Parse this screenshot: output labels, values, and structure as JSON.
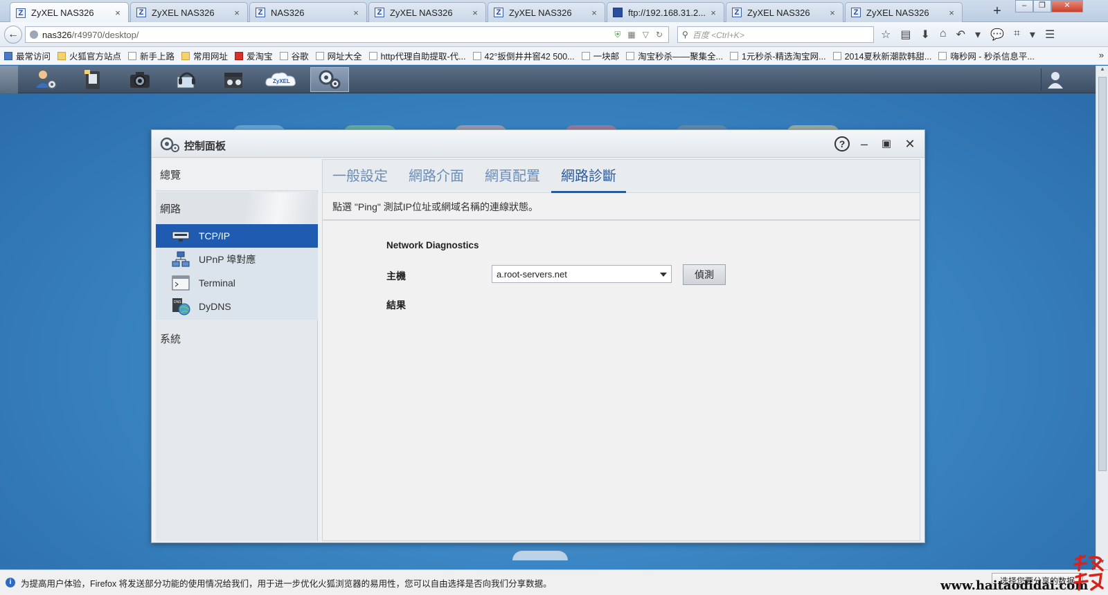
{
  "browser": {
    "tabs": [
      {
        "label": "ZyXEL NAS326",
        "active": true
      },
      {
        "label": "ZyXEL NAS326",
        "active": false
      },
      {
        "label": "NAS326",
        "active": false
      },
      {
        "label": "ZyXEL NAS326",
        "active": false
      },
      {
        "label": "ZyXEL NAS326",
        "active": false
      },
      {
        "label": "ftp://192.168.31.2...",
        "active": false
      },
      {
        "label": "ZyXEL NAS326",
        "active": false
      },
      {
        "label": "ZyXEL NAS326",
        "active": false
      }
    ],
    "url_host": "nas326",
    "url_path": "/r49970/desktop/",
    "search_placeholder": "百度 <Ctrl+K>",
    "bookmarks": [
      "最常访问",
      "火狐官方站点",
      "新手上路",
      "常用网址",
      "爱淘宝",
      "谷歌",
      "网址大全",
      "http代理自助提取-代...",
      "42°扳倒井井窖42 500...",
      "一块邮",
      "淘宝秒杀——聚集全...",
      "1元秒杀-精选淘宝网...",
      "2014夏秋新潮款韩甜...",
      "嗨秒网 - 秒杀信息平..."
    ]
  },
  "window": {
    "title": "控制面板",
    "help_label": "?"
  },
  "sidebar": {
    "overview": "總覽",
    "network": "網路",
    "items": [
      {
        "label": "TCP/IP",
        "icon": "network-card-icon",
        "selected": true
      },
      {
        "label": "UPnP 埠對應",
        "icon": "upnp-icon",
        "selected": false
      },
      {
        "label": "Terminal",
        "icon": "terminal-icon",
        "selected": false
      },
      {
        "label": "DyDNS",
        "icon": "dns-globe-icon",
        "selected": false
      }
    ],
    "system": "系統"
  },
  "content": {
    "tabs": [
      "一般設定",
      "網路介面",
      "網頁配置",
      "網路診斷"
    ],
    "active_tab": 3,
    "description": "點選 \"Ping\" 測試IP位址或網域名稱的連線狀態。",
    "section_title": "Network Diagnostics",
    "host_label": "主機",
    "host_value": "a.root-servers.net",
    "detect_button": "偵測",
    "result_label": "結果"
  },
  "notification": {
    "text": "为提高用户体验，Firefox 将发送部分功能的使用情况给我们，用于进一步优化火狐浏览器的易用性，您可以自由选择是否向我们分享数据。",
    "button": "选择您要分享的数据"
  },
  "watermark": "www.haitaodidai.com",
  "seal_text": "海淘地带"
}
